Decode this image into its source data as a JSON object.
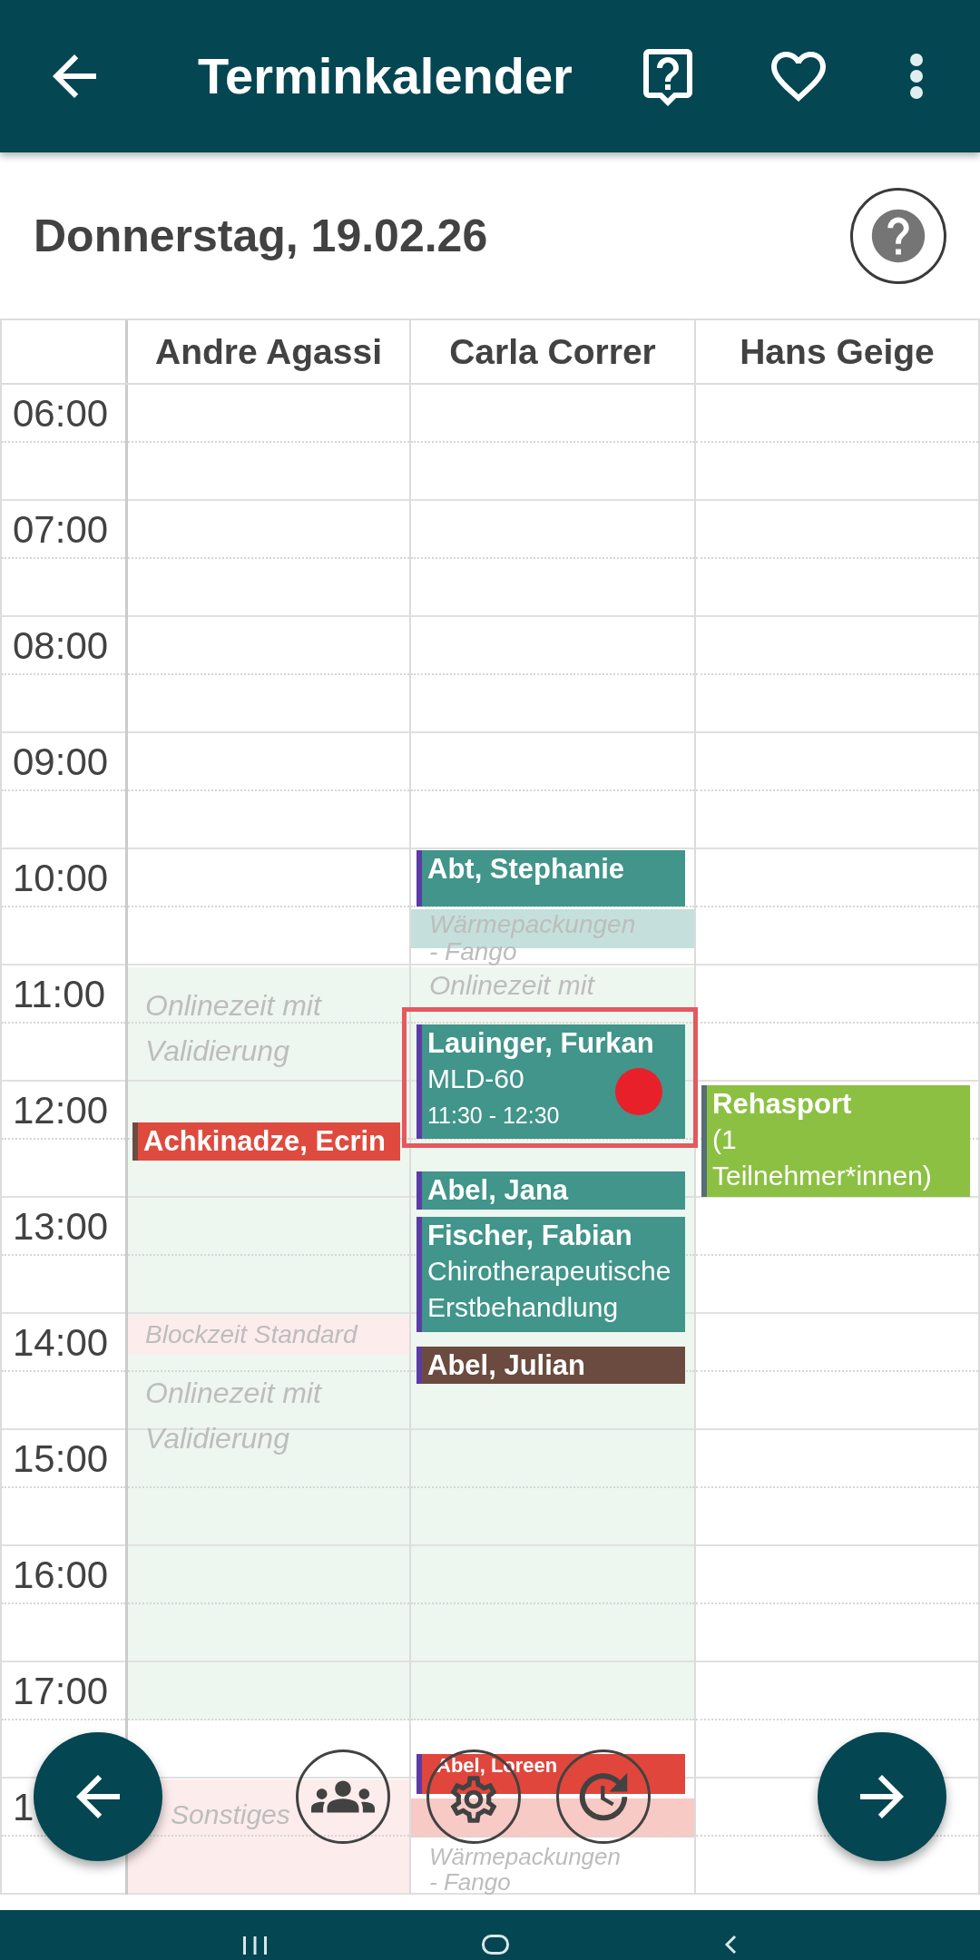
{
  "app_bar": {
    "title": "Terminkalender"
  },
  "date": {
    "title": "Donnerstag, 19.02.26"
  },
  "calendar": {
    "time_labels": [
      "06:00",
      "07:00",
      "08:00",
      "09:00",
      "10:00",
      "11:00",
      "12:00",
      "13:00",
      "14:00",
      "15:00",
      "16:00",
      "17:00",
      "1"
    ],
    "columns": [
      {
        "name": "Andre Agassi",
        "blocks": [
          {
            "label": "Onlinezeit mit Validierung",
            "color": "#edf6ef"
          },
          {
            "label": "Blockzeit Standard",
            "color": "#fdecec"
          },
          {
            "label": "Onlinezeit mit Validierung",
            "color": "#edf6ef"
          },
          {
            "label": "Sonstiges",
            "color": "#fdecec"
          }
        ],
        "events": [
          {
            "name": "Achkinadze, Ecrin",
            "color": "#df4a3f",
            "stripe": {
              "color": "#6d4c41"
            },
            "selected": false,
            "flagged": false
          }
        ]
      },
      {
        "name": "Carla Correr",
        "blocks": [
          {
            "label": "Wärmepackungen - Fango",
            "color": "#c5e0dc"
          },
          {
            "label": "Onlinezeit mit",
            "color": "#edf6ef"
          },
          {
            "label": "Wärmepackungen - Fango",
            "color": "#f7cac6"
          }
        ],
        "events": [
          {
            "name": "Abt, Stephanie",
            "color": "#41958a",
            "stripe": {
              "color": "#5b3ba6"
            },
            "selected": false,
            "flagged": false
          },
          {
            "name": "Lauinger, Furkan",
            "detail": "MLD-60",
            "time": "11:30 - 12:30",
            "color": "#41958a",
            "stripe": {
              "color": "#5b3ba6"
            },
            "selected": true,
            "flagged": true
          },
          {
            "name": "Abel, Jana",
            "color": "#41958a",
            "stripe": {
              "color": "#5b3ba6"
            },
            "selected": false,
            "flagged": false
          },
          {
            "name": "Fischer, Fabian",
            "detail": "Chirotherapeutische Erstbehandlung",
            "color": "#41958a",
            "stripe": {
              "color": "#5b3ba6"
            },
            "selected": false,
            "flagged": false
          },
          {
            "name": "Abel, Julian",
            "color": "#6b4b3f",
            "stripe": {
              "color": "#5b3ba6"
            },
            "selected": false,
            "flagged": false
          },
          {
            "name": "Abel, Loreen",
            "color": "#e0463c",
            "stripe": {
              "color": "#5b3ba6"
            },
            "selected": false,
            "flagged": false
          }
        ]
      },
      {
        "name": "Hans Geige",
        "events": [
          {
            "name": "Rehasport",
            "detail": "(1 Teilnehmer*innen)",
            "color": "#8cc043",
            "stripe": {
              "color": "#566d78"
            },
            "selected": false,
            "flagged": false
          }
        ]
      }
    ]
  }
}
